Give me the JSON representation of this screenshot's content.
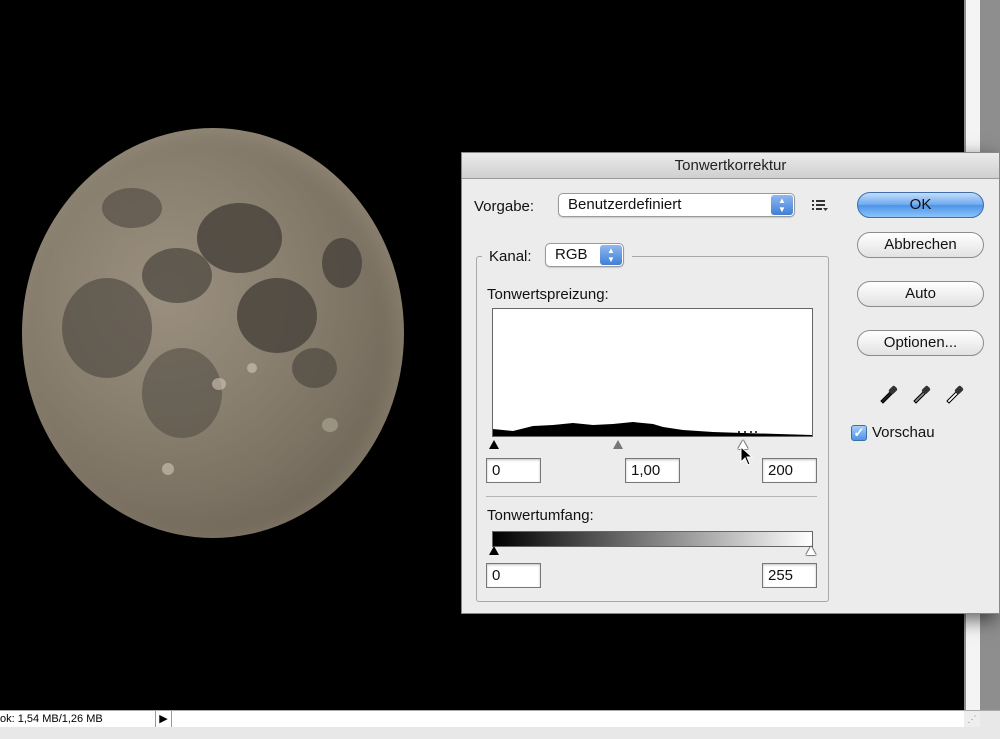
{
  "status_bar": {
    "doc_info": "ok: 1,54 MB/1,26 MB",
    "arrow": "▶"
  },
  "dialog": {
    "title": "Tonwertkorrektur",
    "preset_label": "Vorgabe:",
    "preset_value": "Benutzerdefiniert",
    "channel_label": "Kanal:",
    "channel_value": "RGB",
    "input_levels_label": "Tonwertspreizung:",
    "input_black": "0",
    "input_gamma": "1,00",
    "input_white": "200",
    "output_levels_label": "Tonwertumfang:",
    "output_black": "0",
    "output_white": "255",
    "buttons": {
      "ok": "OK",
      "cancel": "Abbrechen",
      "auto": "Auto",
      "options": "Optionen..."
    },
    "preview_label": "Vorschau",
    "preview_checked": true,
    "eyedroppers": [
      "black-point-eyedropper-icon",
      "gray-point-eyedropper-icon",
      "white-point-eyedropper-icon"
    ]
  },
  "colors": {
    "default_button": "#4b94ea",
    "dialog_bg": "#ececec"
  }
}
